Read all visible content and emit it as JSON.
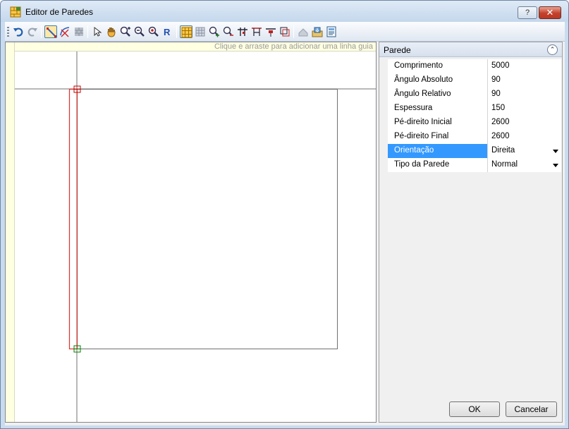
{
  "window": {
    "title": "Editor de Paredes",
    "help_label": "?",
    "close_label": "✕"
  },
  "toolbar": {
    "buttons": [
      {
        "name": "undo-icon",
        "active": false
      },
      {
        "name": "redo-icon",
        "active": false
      },
      {
        "name": "draw-wall-icon",
        "active": true
      },
      {
        "name": "draw-arc-wall-icon",
        "active": false
      },
      {
        "name": "delete-wall-icon",
        "active": false
      },
      {
        "name": "select-pointer-icon",
        "active": false
      },
      {
        "name": "pan-hand-icon",
        "active": false
      },
      {
        "name": "zoom-in-icon",
        "active": false
      },
      {
        "name": "zoom-out-icon",
        "active": false
      },
      {
        "name": "zoom-fit-icon",
        "active": false
      },
      {
        "name": "redraw-icon",
        "active": false
      },
      {
        "name": "snap-grid-icon",
        "active": true
      },
      {
        "name": "grid-icon",
        "active": false
      },
      {
        "name": "add-point-icon",
        "active": false
      },
      {
        "name": "remove-point-icon",
        "active": false
      },
      {
        "name": "split-wall-icon",
        "active": false
      },
      {
        "name": "align-top-icon",
        "active": false
      },
      {
        "name": "align-bottom-icon",
        "active": false
      },
      {
        "name": "mirror-icon",
        "active": false
      },
      {
        "name": "view-3d-icon",
        "active": false
      },
      {
        "name": "import-icon",
        "active": false
      },
      {
        "name": "properties-icon",
        "active": false
      }
    ]
  },
  "canvas": {
    "guide_hint": "Clique e arraste para adicionar uma linha guia"
  },
  "properties": {
    "group_title": "Parede",
    "collapse_label": "⌃",
    "rows": [
      {
        "name": "Comprimento",
        "value": "5000"
      },
      {
        "name": "Ângulo Absoluto",
        "value": "90"
      },
      {
        "name": "Ângulo Relativo",
        "value": "90"
      },
      {
        "name": "Espessura",
        "value": "150"
      },
      {
        "name": "Pé-direito Inicial",
        "value": "2600"
      },
      {
        "name": "Pé-direito Final",
        "value": "2600"
      },
      {
        "name": "Orientação",
        "value": "Direita"
      },
      {
        "name": "Tipo da Parede",
        "value": "Normal"
      }
    ]
  },
  "buttons": {
    "ok_label": "OK",
    "cancel_label": "Cancelar"
  },
  "colors": {
    "wall_selected": "#e03030",
    "wall_start_marker": "#cc0000",
    "wall_end_marker": "#008000",
    "selection": "#3399ff"
  }
}
